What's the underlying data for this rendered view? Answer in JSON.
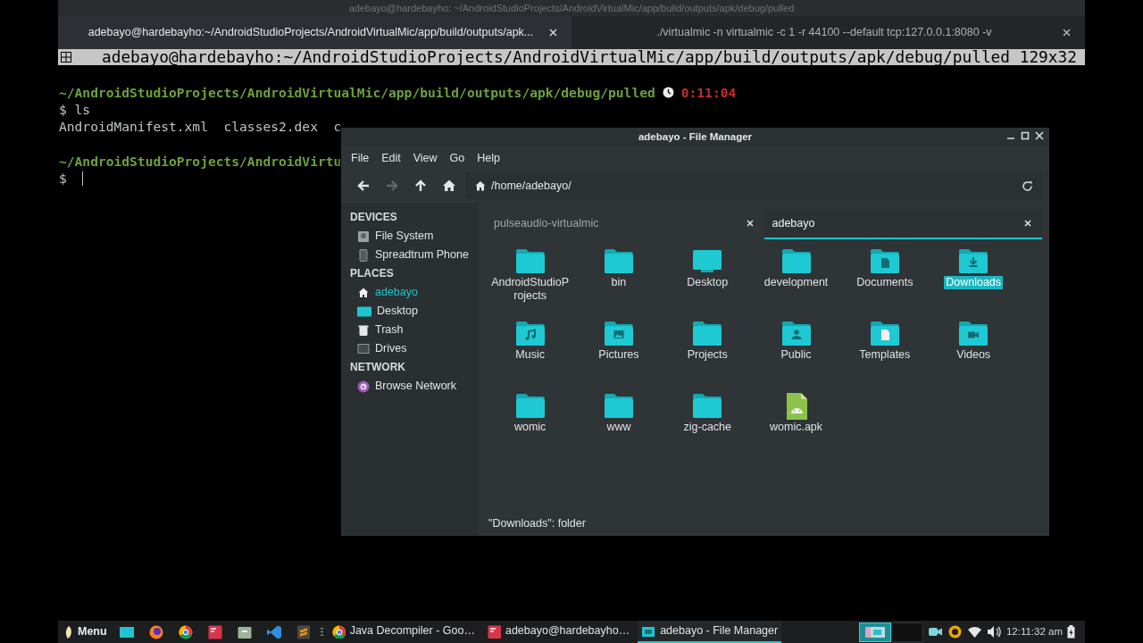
{
  "window": {
    "title": "adebayo@hardebayho: ~/AndroidStudioProjects/AndroidVirtualMic/app/build/outputs/apk/debug/pulled"
  },
  "terminal_tabs": [
    {
      "label": "adebayo@hardebayho:~/AndroidStudioProjects/AndroidVirtualMic/app/build/outputs/apk...",
      "selected": true
    },
    {
      "label": "./virtualmic -n virtualmic -c 1 -r 44100 --default tcp:127.0.0.1:8080 -v",
      "selected": false
    }
  ],
  "terminal_title": "adebayo@hardebayho:~/AndroidStudioProjects/AndroidVirtualMic/app/build/outputs/apk/debug/pulled 129x32",
  "terminal_lines": [
    {
      "kind": "path",
      "text": "~/AndroidStudioProjects/AndroidVirtualMic/app/build/outputs/apk/debug/pulled",
      "time": "0:11:04"
    },
    {
      "kind": "command",
      "prompt": "$",
      "text": "ls"
    },
    {
      "kind": "output",
      "text": "AndroidManifest.xml  classes2.dex  c"
    },
    {
      "kind": "blank"
    },
    {
      "kind": "path",
      "text": "~/AndroidStudioProjects/AndroidVirtu"
    },
    {
      "kind": "cursor",
      "prompt": "$"
    }
  ],
  "file_manager": {
    "title": "adebayo - File Manager",
    "menu": [
      "File",
      "Edit",
      "View",
      "Go",
      "Help"
    ],
    "toolbar": [
      {
        "kind": "back",
        "disabled": false
      },
      {
        "kind": "forward",
        "disabled": true
      },
      {
        "kind": "up",
        "disabled": false
      },
      {
        "kind": "home",
        "disabled": false
      }
    ],
    "location": "/home/adebayo/",
    "sidebar": [
      {
        "heading": "DEVICES",
        "items": [
          {
            "label": "File System",
            "kind": "drive",
            "selected": false
          },
          {
            "label": "Spreadtrum Phone",
            "kind": "phone",
            "selected": false
          }
        ]
      },
      {
        "heading": "PLACES",
        "items": [
          {
            "label": "adebayo",
            "kind": "home",
            "selected": true
          },
          {
            "label": "Desktop",
            "kind": "desktop",
            "selected": false
          },
          {
            "label": "Trash",
            "kind": "trash",
            "selected": false
          },
          {
            "label": "Drives",
            "kind": "drives",
            "selected": false
          }
        ]
      },
      {
        "heading": "NETWORK",
        "items": [
          {
            "label": "Browse Network",
            "kind": "network",
            "selected": false
          }
        ]
      }
    ],
    "tabs": [
      {
        "label": "pulseaudio-virtualmic",
        "selected": false
      },
      {
        "label": "adebayo",
        "selected": true
      }
    ],
    "items": [
      {
        "label": "AndroidStudioProjects",
        "kind": "folder",
        "selected": false
      },
      {
        "label": "bin",
        "kind": "folder",
        "selected": false
      },
      {
        "label": "Desktop",
        "kind": "desktop",
        "selected": false
      },
      {
        "label": "development",
        "kind": "folder",
        "selected": false
      },
      {
        "label": "Documents",
        "kind": "documents",
        "selected": false
      },
      {
        "label": "Downloads",
        "kind": "downloads",
        "selected": true
      },
      {
        "label": "Music",
        "kind": "music",
        "selected": false
      },
      {
        "label": "Pictures",
        "kind": "pictures",
        "selected": false
      },
      {
        "label": "Projects",
        "kind": "folder",
        "selected": false
      },
      {
        "label": "Public",
        "kind": "public",
        "selected": false
      },
      {
        "label": "Templates",
        "kind": "templates",
        "selected": false
      },
      {
        "label": "Videos",
        "kind": "videos",
        "selected": false
      },
      {
        "label": "womic",
        "kind": "folder",
        "selected": false
      },
      {
        "label": "www",
        "kind": "folder",
        "selected": false
      },
      {
        "label": "zig-cache",
        "kind": "folder",
        "selected": false
      },
      {
        "label": "womic.apk",
        "kind": "apk",
        "selected": false
      }
    ],
    "status": "\"Downloads\": folder"
  },
  "taskbar": {
    "menu": "Menu",
    "tasks": [
      {
        "label": "Java Decompiler - Goo…",
        "kind": "browser",
        "selected": false
      },
      {
        "label": "adebayo@hardebayho…",
        "kind": "terminal",
        "selected": false
      },
      {
        "label": "adebayo - File Manager",
        "kind": "files",
        "selected": true
      }
    ],
    "workspaces": [
      {
        "selected": true
      },
      {
        "selected": false
      }
    ],
    "clock": "12:11:32 am"
  }
}
